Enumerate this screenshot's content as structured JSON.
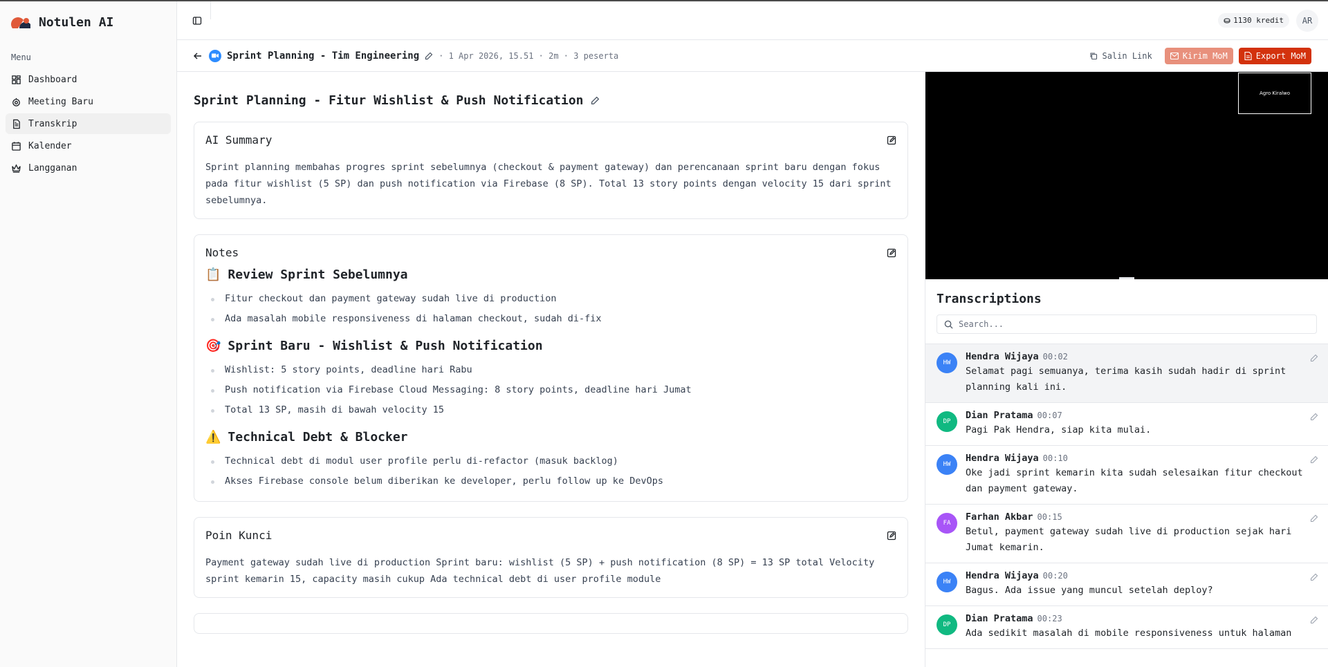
{
  "app": {
    "name": "Notulen AI"
  },
  "sidebar": {
    "heading": "Menu",
    "items": [
      {
        "label": "Dashboard",
        "icon": "dashboard-icon"
      },
      {
        "label": "Meeting Baru",
        "icon": "bot-icon"
      },
      {
        "label": "Transkrip",
        "icon": "file-text-icon",
        "active": true
      },
      {
        "label": "Kalender",
        "icon": "calendar-icon"
      },
      {
        "label": "Langganan",
        "icon": "crown-icon"
      }
    ]
  },
  "topbar": {
    "credits": "1130 kredit",
    "avatar": "AR"
  },
  "meeting": {
    "title": "Sprint Planning - Tim Engineering",
    "meta": "· 1 Apr 2026, 15.51 · 2m · 3 peserta",
    "copy_link": "Salin Link",
    "send_mom": "Kirim MoM",
    "export_mom": "Export MoM"
  },
  "doc": {
    "title": "Sprint Planning - Fitur Wishlist & Push Notification",
    "summary": {
      "title": "AI Summary",
      "text": "Sprint planning membahas progres sprint sebelumnya (checkout & payment gateway) dan perencanaan sprint baru dengan fokus pada fitur wishlist (5 SP) dan push notification via Firebase (8 SP). Total 13 story points dengan velocity 15 dari sprint sebelumnya."
    },
    "notes": {
      "title": "Notes",
      "sections": [
        {
          "emoji": "📋",
          "heading": "Review Sprint Sebelumnya",
          "items": [
            "Fitur checkout dan payment gateway sudah live di production",
            "Ada masalah mobile responsiveness di halaman checkout, sudah di-fix"
          ]
        },
        {
          "emoji": "🎯",
          "heading": "Sprint Baru - Wishlist & Push Notification",
          "items": [
            "Wishlist: 5 story points, deadline hari Rabu",
            "Push notification via Firebase Cloud Messaging: 8 story points, deadline hari Jumat",
            "Total 13 SP, masih di bawah velocity 15"
          ]
        },
        {
          "emoji": "⚠️",
          "heading": "Technical Debt & Blocker",
          "items": [
            "Technical debt di modul user profile perlu di-refactor (masuk backlog)",
            "Akses Firebase console belum diberikan ke developer, perlu follow up ke DevOps"
          ]
        }
      ]
    },
    "key_points": {
      "title": "Poin Kunci",
      "text": "Payment gateway sudah live di production Sprint baru: wishlist (5 SP) + push notification (8 SP) = 13 SP total Velocity sprint kemarin 15, capacity masih cukup Ada technical debt di user profile module"
    }
  },
  "video": {
    "participant": "Agro Kiralwo"
  },
  "transcriptions": {
    "title": "Transcriptions",
    "search_placeholder": "Search...",
    "items": [
      {
        "initials": "HW",
        "name": "Hendra Wijaya",
        "time": "00:02",
        "color": "#3b82f6",
        "text": "Selamat pagi semuanya, terima kasih sudah hadir di sprint planning kali ini.",
        "active": true
      },
      {
        "initials": "DP",
        "name": "Dian Pratama",
        "time": "00:07",
        "color": "#10b981",
        "text": "Pagi Pak Hendra, siap kita mulai."
      },
      {
        "initials": "HW",
        "name": "Hendra Wijaya",
        "time": "00:10",
        "color": "#3b82f6",
        "text": "Oke jadi sprint kemarin kita sudah selesaikan fitur checkout dan payment gateway."
      },
      {
        "initials": "FA",
        "name": "Farhan Akbar",
        "time": "00:15",
        "color": "#a855f7",
        "text": "Betul, payment gateway sudah live di production sejak hari Jumat kemarin."
      },
      {
        "initials": "HW",
        "name": "Hendra Wijaya",
        "time": "00:20",
        "color": "#3b82f6",
        "text": "Bagus. Ada issue yang muncul setelah deploy?"
      },
      {
        "initials": "DP",
        "name": "Dian Pratama",
        "time": "00:23",
        "color": "#10b981",
        "text": "Ada sedikit masalah di mobile responsiveness untuk halaman"
      }
    ]
  },
  "colors": {
    "accent": "#d3320d",
    "accent_light": "#e8907c",
    "zoom_blue": "#2d8cff"
  }
}
